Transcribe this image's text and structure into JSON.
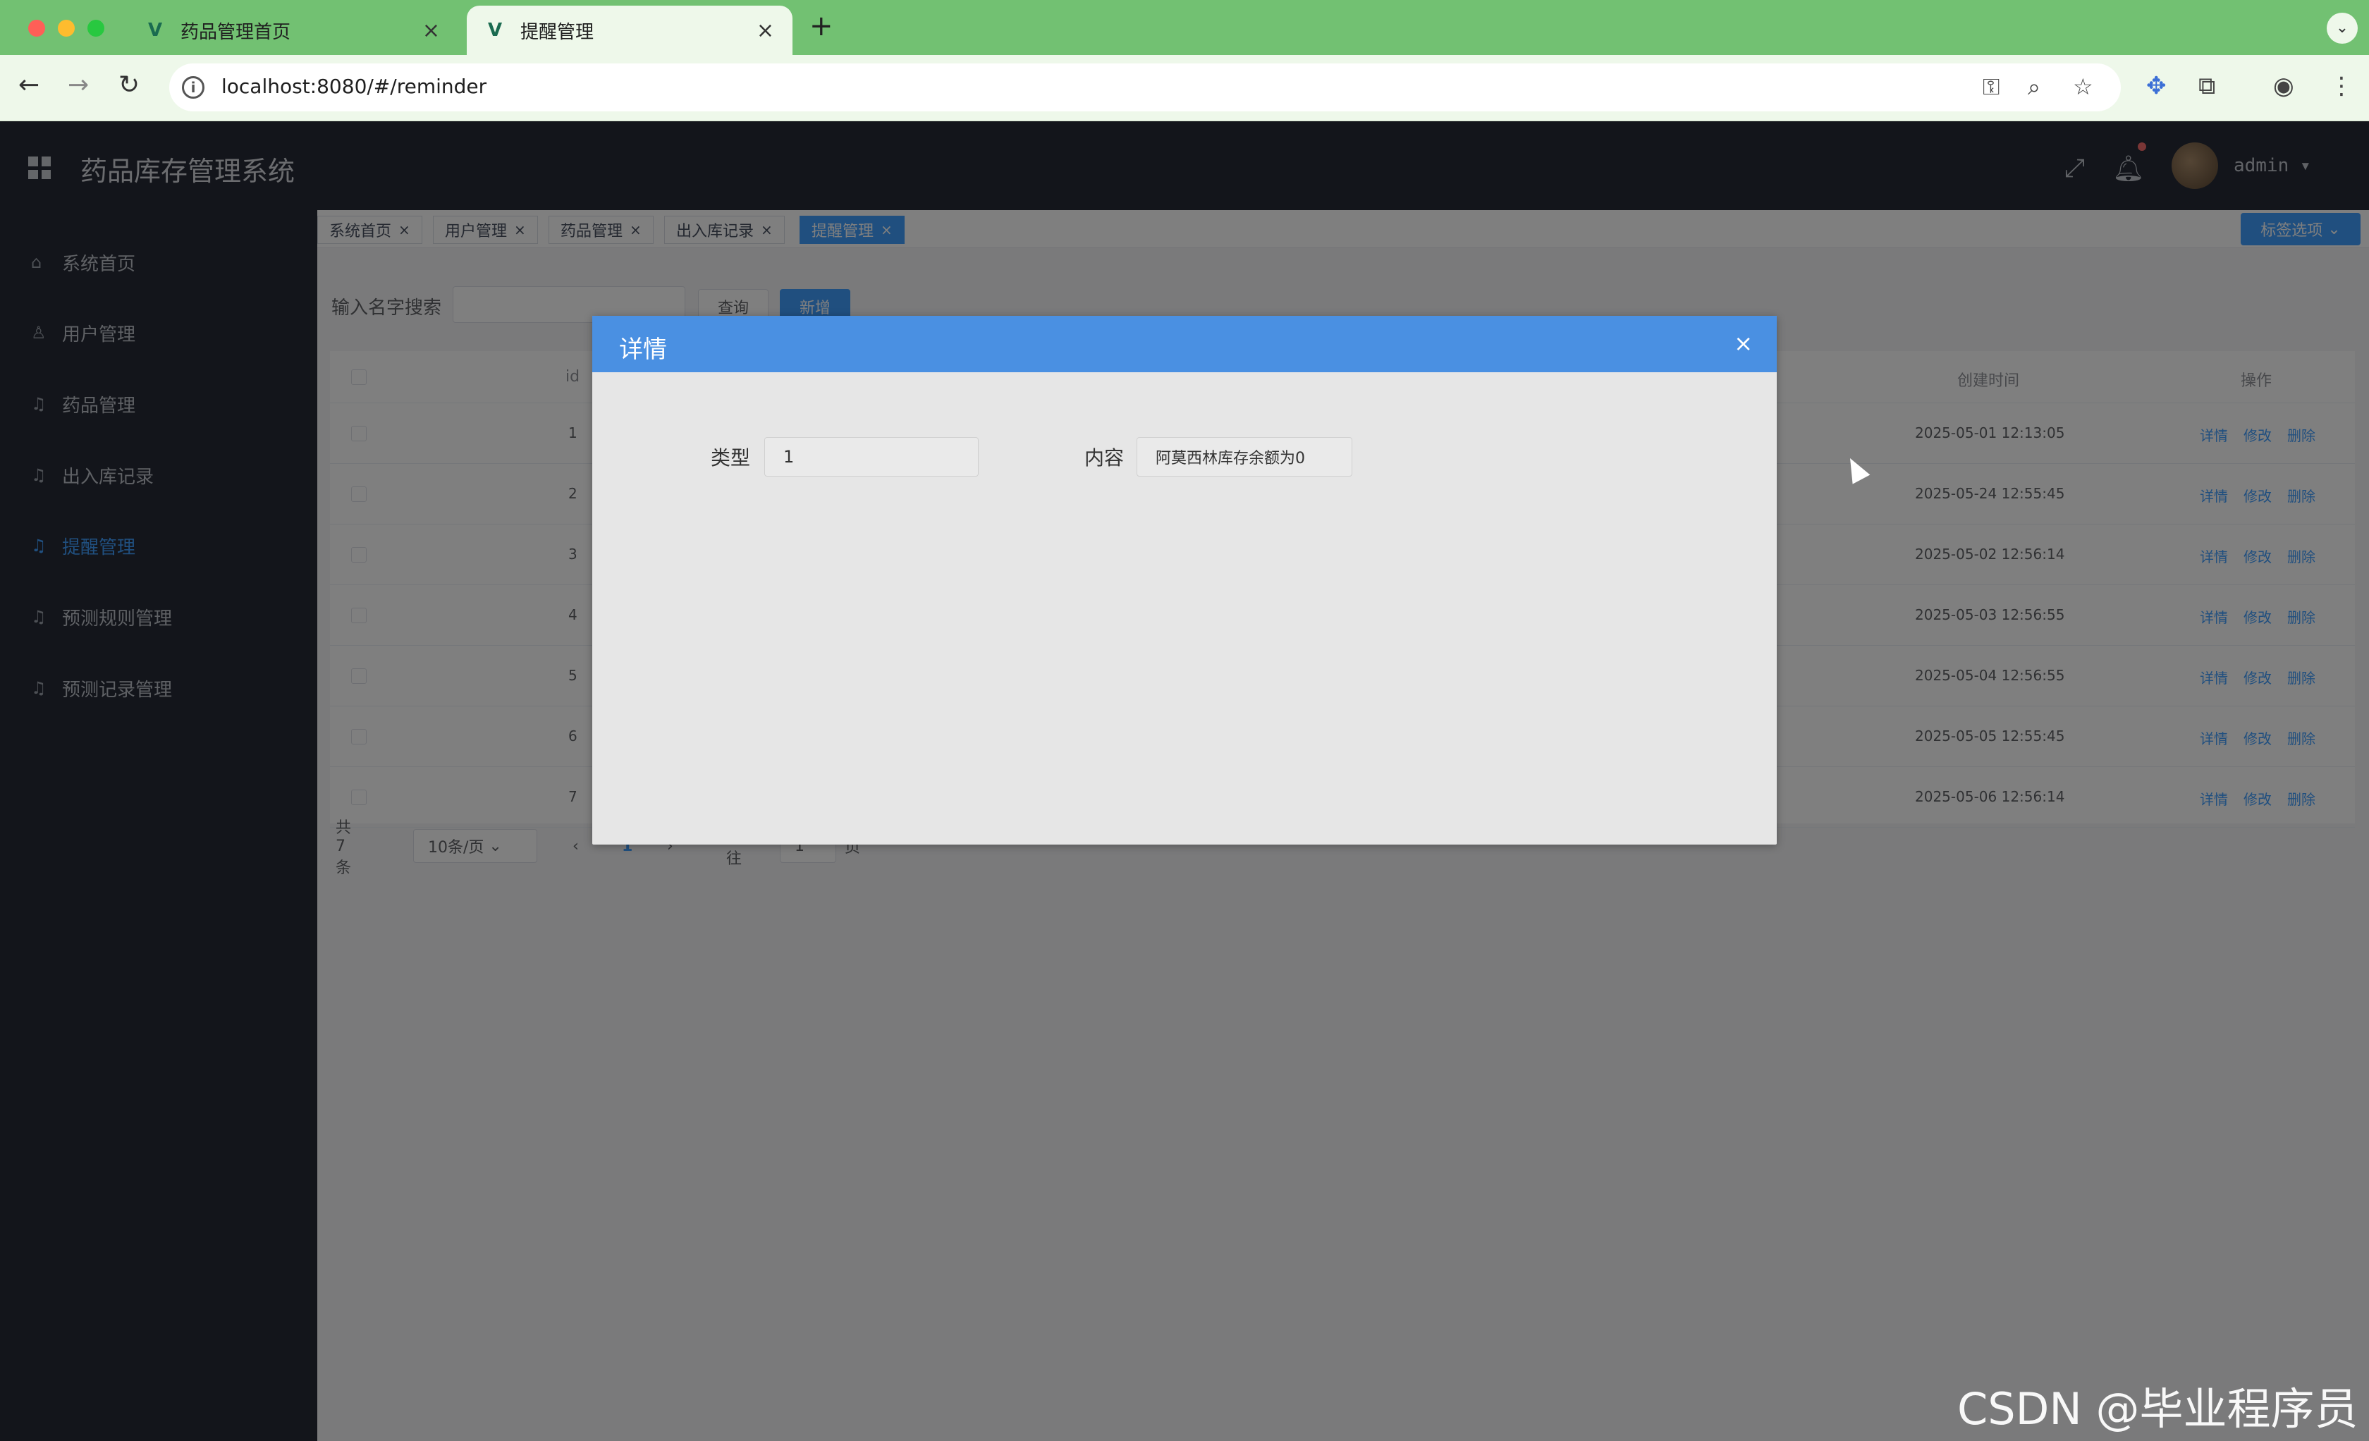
{
  "browser": {
    "tabs": [
      {
        "label": "药品管理首页",
        "active": false
      },
      {
        "label": "提醒管理",
        "active": true
      }
    ],
    "url": "localhost:8080/#/reminder"
  },
  "app": {
    "title": "药品库存管理系统",
    "user": "admin"
  },
  "sidebar": {
    "items": [
      {
        "label": "系统首页",
        "icon": "home-icon",
        "active": false
      },
      {
        "label": "用户管理",
        "icon": "user-icon",
        "active": false
      },
      {
        "label": "药品管理",
        "icon": "bell-icon",
        "active": false
      },
      {
        "label": "出入库记录",
        "icon": "bell-icon",
        "active": false
      },
      {
        "label": "提醒管理",
        "icon": "bell-icon",
        "active": true
      },
      {
        "label": "预测规则管理",
        "icon": "bell-icon",
        "active": false
      },
      {
        "label": "预测记录管理",
        "icon": "bell-icon",
        "active": false
      }
    ]
  },
  "tagsview": {
    "tags": [
      {
        "label": "系统首页",
        "active": false
      },
      {
        "label": "用户管理",
        "active": false
      },
      {
        "label": "药品管理",
        "active": false
      },
      {
        "label": "出入库记录",
        "active": false
      },
      {
        "label": "提醒管理",
        "active": true
      }
    ],
    "options_label": "标签选项"
  },
  "search": {
    "label": "输入名字搜索",
    "query_label": "查询",
    "add_label": "新增"
  },
  "table": {
    "headers": {
      "id": "id",
      "created": "创建时间",
      "ops": "操作"
    },
    "rows": [
      {
        "id": "1",
        "created": "2025-05-01 12:13:05"
      },
      {
        "id": "2",
        "created": "2025-05-24 12:55:45"
      },
      {
        "id": "3",
        "created": "2025-05-02 12:56:14"
      },
      {
        "id": "4",
        "created": "2025-05-03 12:56:55"
      },
      {
        "id": "5",
        "created": "2025-05-04 12:56:55"
      },
      {
        "id": "6",
        "created": "2025-05-05 12:55:45"
      },
      {
        "id": "7",
        "created": "2025-05-06 12:56:14"
      }
    ],
    "actions": {
      "detail": "详情",
      "edit": "修改",
      "delete": "删除"
    }
  },
  "pagination": {
    "total": "共 7 条",
    "page_size": "10条/页",
    "current": "1",
    "goto_prefix": "前往",
    "goto_value": "1",
    "goto_suffix": "页"
  },
  "dialog": {
    "title": "详情",
    "type_label": "类型",
    "type_value": "1",
    "content_label": "内容",
    "content_value": "阿莫西林库存余额为0"
  },
  "watermark": "CSDN @毕业程序员"
}
